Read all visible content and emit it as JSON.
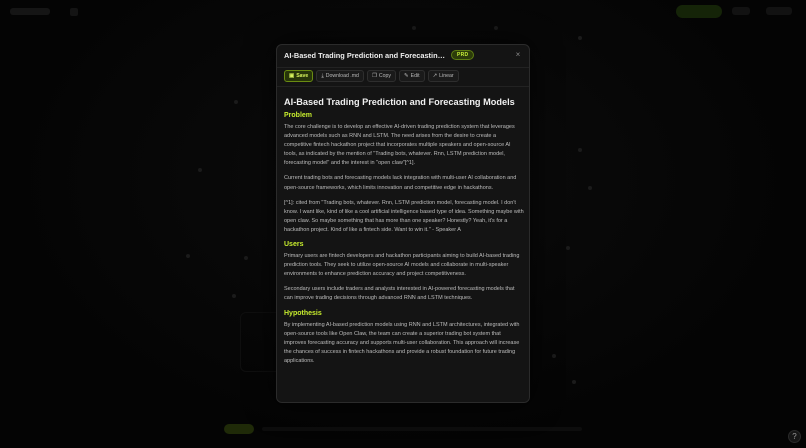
{
  "modal": {
    "title": "AI-Based Trading Prediction and Forecasting ...",
    "badge": "PRD",
    "close_glyph": "×"
  },
  "toolbar": {
    "buttons": [
      {
        "label": "Save",
        "icon": "save-icon",
        "glyph": "▣"
      },
      {
        "label": "Download .md",
        "icon": "download-icon",
        "glyph": "⤓"
      },
      {
        "label": "Copy",
        "icon": "copy-icon",
        "glyph": "❐"
      },
      {
        "label": "Edit",
        "icon": "edit-icon",
        "glyph": "✎"
      },
      {
        "label": "Linear",
        "icon": "external-link-icon",
        "glyph": "↗"
      }
    ]
  },
  "document": {
    "title": "AI-Based Trading Prediction and Forecasting Models",
    "sections": [
      {
        "heading": "Problem",
        "paragraphs": [
          "The core challenge is to develop an effective AI-driven trading prediction system that leverages advanced models such as RNN and LSTM. The need arises from the desire to create a competitive fintech hackathon project that incorporates multiple speakers and open-source AI tools, as indicated by the mention of \"Trading bots, whatever. Rnn, LSTM prediction model, forecasting model\" and the interest in \"open claw\"[^1].",
          "Current trading bots and forecasting models lack integration with multi-user AI collaboration and open-source frameworks, which limits innovation and competitive edge in hackathons.",
          "[^1]: cited from \"Trading bots, whatever. Rnn, LSTM prediction model, forecasting model. I don't know. I want like, kind of like a cool artificial intelligence based type of idea. Something maybe with open claw. So maybe something that has more than one speaker? Honestly? Yeah, it's for a hackathon project. Kind of like a fintech side. Want to win it.\" - Speaker A"
        ]
      },
      {
        "heading": "Users",
        "paragraphs": [
          "Primary users are fintech developers and hackathon participants aiming to build AI-based trading prediction tools. They seek to utilize open-source AI models and collaborate in multi-speaker environments to enhance prediction accuracy and project competitiveness.",
          "Secondary users include traders and analysts interested in AI-powered forecasting models that can improve trading decisions through advanced RNN and LSTM techniques."
        ]
      },
      {
        "heading": "Hypothesis",
        "paragraphs": [
          "By implementing AI-based prediction models using RNN and LSTM architectures, integrated with open-source tools like Open Claw, the team can create a superior trading bot system that improves forecasting accuracy and supports multi-user collaboration. This approach will increase the chances of success in fintech hackathons and provide a robust foundation for future trading applications."
        ]
      }
    ]
  },
  "help": {
    "label": "?"
  },
  "colors": {
    "accent": "#c8ee2e",
    "badge_bg": "#2c3b0a",
    "modal_bg": "#141414",
    "page_bg": "#050505"
  }
}
